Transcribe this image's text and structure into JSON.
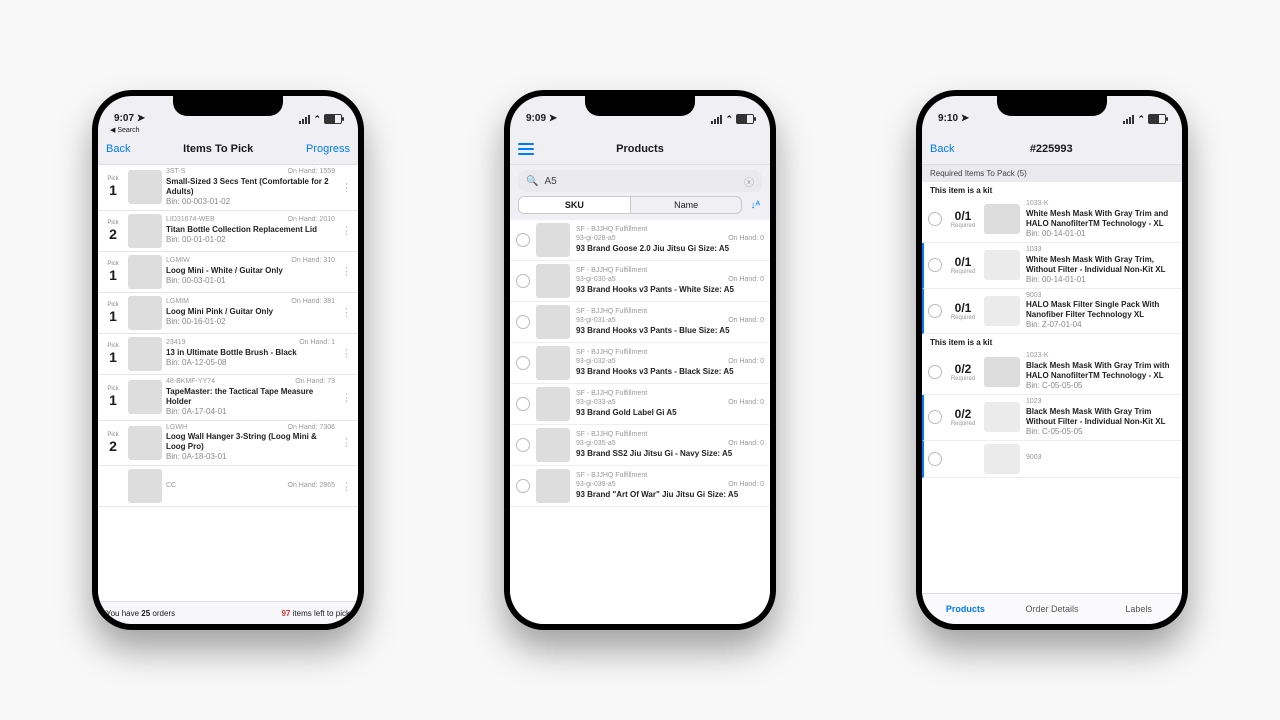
{
  "screens": {
    "pick": {
      "status_time": "9:07",
      "back_to_search": "Search",
      "nav_back": "Back",
      "title": "Items To Pick",
      "nav_right": "Progress",
      "items": [
        {
          "pick_label": "Pick",
          "qty": "1",
          "sku": "3ST-S",
          "on_hand": "On Hand: 1559",
          "name": "Small-Sized 3 Secs Tent (Comfortable for 2 Adults)",
          "bin": "Bin: 00-003-01-02"
        },
        {
          "pick_label": "Pick",
          "qty": "2",
          "sku": "LID31674-WEB",
          "on_hand": "On Hand: 2010",
          "name": "Titan Bottle Collection Replacement Lid",
          "bin": "Bin: 00-01-01-02"
        },
        {
          "pick_label": "Pick",
          "qty": "1",
          "sku": "LGMIW",
          "on_hand": "On Hand: 310",
          "name": "Loog Mini - White / Guitar Only",
          "bin": "Bin: 00-03-01-01"
        },
        {
          "pick_label": "Pick",
          "qty": "1",
          "sku": "LGMIM",
          "on_hand": "On Hand: 381",
          "name": "Loog Mini Pink / Guitar Only",
          "bin": "Bin: 00-16-01-02"
        },
        {
          "pick_label": "Pick",
          "qty": "1",
          "sku": "23419",
          "on_hand": "On Hand: 1",
          "name": "13 in Ultimate Bottle Brush - Black",
          "bin": "Bin: 0A-12-05-08"
        },
        {
          "pick_label": "Pick",
          "qty": "1",
          "sku": "48-BKMF-YY74",
          "on_hand": "On Hand: 73",
          "name": "TapeMaster: the Tactical Tape Measure Holder",
          "bin": "Bin: 0A-17-04-01"
        },
        {
          "pick_label": "Pick",
          "qty": "2",
          "sku": "LGWH",
          "on_hand": "On Hand: 7306",
          "name": "Loog Wall Hanger 3-String (Loog Mini & Loog Pro)",
          "bin": "Bin: 0A-18-03-01"
        },
        {
          "pick_label": "",
          "qty": "",
          "sku": "CC",
          "on_hand": "On Hand: 2865",
          "name": "",
          "bin": ""
        }
      ],
      "footer_prefix": "You have ",
      "footer_count": "25",
      "footer_suffix": " orders",
      "footer_right_count": "97",
      "footer_right_suffix": " items left to pick"
    },
    "products": {
      "status_time": "9:09",
      "title": "Products",
      "search_value": "A5",
      "seg_sku": "SKU",
      "seg_name": "Name",
      "items": [
        {
          "src": "SF - BJJHQ Fulfillment",
          "sku": "93-gi-028-a5",
          "on_hand": "On Hand: 0",
          "name": "93 Brand Goose 2.0 Jiu Jitsu Gi  Size: A5"
        },
        {
          "src": "SF - BJJHQ Fulfillment",
          "sku": "93-gi-030-a5",
          "on_hand": "On Hand: 0",
          "name": "93 Brand Hooks v3 Pants - White Size: A5"
        },
        {
          "src": "SF - BJJHQ Fulfillment",
          "sku": "93-gi-031-a5",
          "on_hand": "On Hand: 0",
          "name": "93 Brand Hooks v3 Pants - Blue Size: A5"
        },
        {
          "src": "SF - BJJHQ Fulfillment",
          "sku": "93-gi-032-a5",
          "on_hand": "On Hand: 0",
          "name": "93 Brand Hooks v3 Pants - Black Size: A5"
        },
        {
          "src": "SF - BJJHQ Fulfillment",
          "sku": "93-gi-033-a5",
          "on_hand": "On Hand: 0",
          "name": "93 Brand Gold Label Gi A5"
        },
        {
          "src": "SF - BJJHQ Fulfillment",
          "sku": "93-gi-035-a5",
          "on_hand": "On Hand: 0",
          "name": "93 Brand SS2 Jiu Jitsu Gi - Navy Size: A5"
        },
        {
          "src": "SF - BJJHQ Fulfillment",
          "sku": "93-gi-039-a5",
          "on_hand": "On Hand: 0",
          "name": "93 Brand \"Art Of War\" Jiu Jitsu Gi Size: A5"
        }
      ]
    },
    "order": {
      "status_time": "9:10",
      "nav_back": "Back",
      "title": "#225993",
      "required_header": "Required Items To Pack (5)",
      "kit_label_a": "This item is a kit",
      "kit_label_b": "This item is a kit",
      "itemsA": [
        {
          "qty": "0/1",
          "req": "Required",
          "sku": "1033-K",
          "name": "White Mesh Mask With Gray Trim and HALO NanofilterTM Technology - XL",
          "bin": "Bin: 00-14-01-01",
          "flagged": false
        },
        {
          "qty": "0/1",
          "req": "Required",
          "sku": "1033",
          "name": "White Mesh Mask With Gray Trim, Without Filter - Individual Non-Kit XL",
          "bin": "Bin: 00-14-01-01",
          "flagged": true
        },
        {
          "qty": "0/1",
          "req": "Required",
          "sku": "9003",
          "name": "HALO Mask Filter Single Pack With Nanofiber Filter Technology XL",
          "bin": "Bin: Z-07-01-04",
          "flagged": true
        }
      ],
      "itemsB": [
        {
          "qty": "0/2",
          "req": "Required",
          "sku": "1023-K",
          "name": "Black Mesh Mask With Gray Trim with HALO NanofilterTM Technology - XL",
          "bin": "Bin: C-05-05-05",
          "flagged": false
        },
        {
          "qty": "0/2",
          "req": "Required",
          "sku": "1023",
          "name": "Black Mesh Mask With Gray Trim Without Filter - Individual Non-Kit XL",
          "bin": "Bin: C-05-05-05",
          "flagged": true
        },
        {
          "qty": "",
          "req": "",
          "sku": "9003",
          "name": "",
          "bin": "",
          "flagged": true
        }
      ],
      "tabs": [
        "Products",
        "Order Details",
        "Labels"
      ]
    }
  }
}
